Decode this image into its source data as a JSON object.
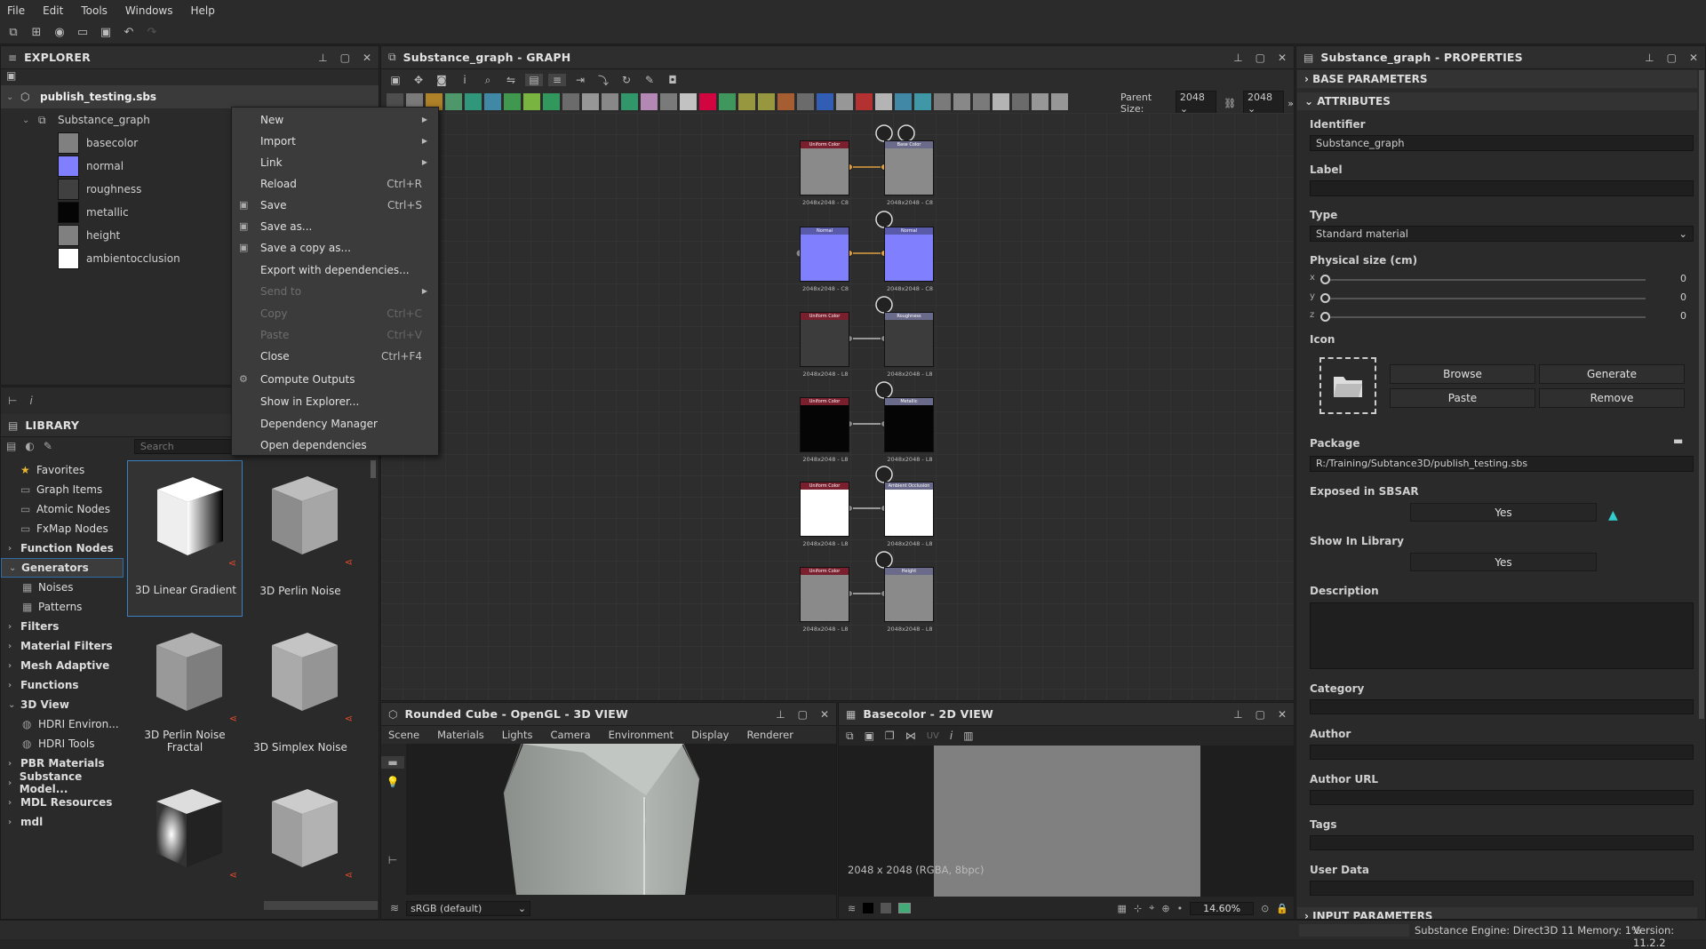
{
  "menubar": {
    "items": [
      "File",
      "Edit",
      "Tools",
      "Windows",
      "Help"
    ]
  },
  "explorer": {
    "title": "EXPLORER",
    "package": "publish_testing.sbs",
    "graph": "Substance_graph",
    "outputs": [
      {
        "name": "basecolor",
        "color": "#808080"
      },
      {
        "name": "normal",
        "color": "#8080ff"
      },
      {
        "name": "roughness",
        "color": "#404040"
      },
      {
        "name": "metallic",
        "color": "#050505"
      },
      {
        "name": "height",
        "color": "#808080"
      },
      {
        "name": "ambientocclusion",
        "color": "#ffffff"
      }
    ]
  },
  "context_menu": {
    "items": [
      {
        "label": "New",
        "shortcut": "",
        "submenu": true,
        "disabled": false
      },
      {
        "label": "Import",
        "shortcut": "",
        "submenu": true,
        "disabled": false
      },
      {
        "label": "Link",
        "shortcut": "",
        "submenu": true,
        "disabled": false
      },
      {
        "label": "Reload",
        "shortcut": "Ctrl+R",
        "submenu": false,
        "disabled": false
      },
      {
        "label": "Save",
        "shortcut": "Ctrl+S",
        "submenu": false,
        "disabled": false
      },
      {
        "label": "Save as...",
        "shortcut": "",
        "submenu": false,
        "disabled": false
      },
      {
        "label": "Save a copy as...",
        "shortcut": "",
        "submenu": false,
        "disabled": false
      },
      {
        "label": "Export with dependencies...",
        "shortcut": "",
        "submenu": false,
        "disabled": false
      },
      {
        "label": "Send to",
        "shortcut": "",
        "submenu": true,
        "disabled": true
      },
      {
        "label": "Copy",
        "shortcut": "Ctrl+C",
        "submenu": false,
        "disabled": true
      },
      {
        "label": "Paste",
        "shortcut": "Ctrl+V",
        "submenu": false,
        "disabled": true
      },
      {
        "label": "Close",
        "shortcut": "Ctrl+F4",
        "submenu": false,
        "disabled": false
      },
      {
        "label": "Compute Outputs",
        "shortcut": "",
        "submenu": false,
        "disabled": false
      },
      {
        "label": "Show in Explorer...",
        "shortcut": "",
        "submenu": false,
        "disabled": false
      },
      {
        "label": "Dependency Manager",
        "shortcut": "",
        "submenu": false,
        "disabled": false
      },
      {
        "label": "Open dependencies",
        "shortcut": "",
        "submenu": false,
        "disabled": false
      }
    ]
  },
  "library": {
    "title": "LIBRARY",
    "search_placeholder": "Search",
    "categories": [
      {
        "label": "Favorites",
        "bold": false,
        "arrow": "",
        "icon": "star"
      },
      {
        "label": "Graph Items",
        "bold": false,
        "arrow": "",
        "icon": "box"
      },
      {
        "label": "Atomic Nodes",
        "bold": false,
        "arrow": "",
        "icon": "box"
      },
      {
        "label": "FxMap Nodes",
        "bold": false,
        "arrow": "",
        "icon": "box"
      },
      {
        "label": "Function Nodes",
        "bold": true,
        "arrow": "›",
        "icon": ""
      },
      {
        "label": "Generators",
        "bold": true,
        "arrow": "⌄",
        "icon": ""
      },
      {
        "label": "Noises",
        "bold": false,
        "arrow": "",
        "icon": "grid",
        "indent": true
      },
      {
        "label": "Patterns",
        "bold": false,
        "arrow": "",
        "icon": "grid",
        "indent": true
      },
      {
        "label": "Filters",
        "bold": true,
        "arrow": "›",
        "icon": ""
      },
      {
        "label": "Material Filters",
        "bold": true,
        "arrow": "›",
        "icon": ""
      },
      {
        "label": "Mesh Adaptive",
        "bold": true,
        "arrow": "›",
        "icon": ""
      },
      {
        "label": "Functions",
        "bold": true,
        "arrow": "›",
        "icon": ""
      },
      {
        "label": "3D View",
        "bold": true,
        "arrow": "⌄",
        "icon": ""
      },
      {
        "label": "HDRI Environ...",
        "bold": false,
        "arrow": "",
        "icon": "globe",
        "indent": true
      },
      {
        "label": "HDRI Tools",
        "bold": false,
        "arrow": "",
        "icon": "globe",
        "indent": true
      },
      {
        "label": "PBR Materials",
        "bold": true,
        "arrow": "›",
        "icon": ""
      },
      {
        "label": "Substance Model...",
        "bold": true,
        "arrow": "›",
        "icon": ""
      },
      {
        "label": "MDL Resources",
        "bold": true,
        "arrow": "›",
        "icon": ""
      },
      {
        "label": "mdl",
        "bold": true,
        "arrow": "›",
        "icon": ""
      }
    ],
    "items": [
      "3D Linear Gradient",
      "3D Perlin Noise",
      "3D Perlin Noise Fractal",
      "3D Simplex Noise",
      "",
      ""
    ]
  },
  "graph": {
    "title": "Substance_graph - GRAPH",
    "parent_size_label": "Parent Size:",
    "parent_size": "2048",
    "size": "2048",
    "rows": [
      {
        "in_header": "Uniform Color",
        "out_header": "Base Color",
        "in_color": "#8a8a8a",
        "out_color": "#8a8a8a",
        "hdr_in": "#7a1f2e",
        "hdr_out": "#6a6a8a",
        "size_in": "2048x2048 - C8",
        "size_out": "2048x2048 - C8",
        "link": "#e0a040"
      },
      {
        "in_header": "Normal",
        "out_header": "Normal",
        "in_color": "#8080ff",
        "out_color": "#8080ff",
        "hdr_in": "#5a5aaa",
        "hdr_out": "#5a5aaa",
        "size_in": "2048x2048 - C8",
        "size_out": "2048x2048 - C8",
        "link": "#e0a040"
      },
      {
        "in_header": "Uniform Color",
        "out_header": "Roughness",
        "in_color": "#3c3c3c",
        "out_color": "#3c3c3c",
        "hdr_in": "#7a1f2e",
        "hdr_out": "#6a6a8a",
        "size_in": "2048x2048 - L8",
        "size_out": "2048x2048 - L8",
        "link": "#bbbbbb"
      },
      {
        "in_header": "Uniform Color",
        "out_header": "Metallic",
        "in_color": "#050505",
        "out_color": "#050505",
        "hdr_in": "#7a1f2e",
        "hdr_out": "#6a6a8a",
        "size_in": "2048x2048 - L8",
        "size_out": "2048x2048 - L8",
        "link": "#bbbbbb"
      },
      {
        "in_header": "Uniform Color",
        "out_header": "Ambient Occlusion",
        "in_color": "#ffffff",
        "out_color": "#ffffff",
        "hdr_in": "#7a1f2e",
        "hdr_out": "#6a6a8a",
        "size_in": "2048x2048 - L8",
        "size_out": "2048x2048 - L8",
        "link": "#bbbbbb"
      },
      {
        "in_header": "Uniform Color",
        "out_header": "Height",
        "in_color": "#8a8a8a",
        "out_color": "#8a8a8a",
        "hdr_in": "#7a1f2e",
        "hdr_out": "#6a6a8a",
        "size_in": "2048x2048 - L8",
        "size_out": "2048x2048 - L8",
        "link": "#bbbbbb"
      }
    ]
  },
  "view3d": {
    "title": "Rounded Cube - OpenGL - 3D VIEW",
    "menu": [
      "Scene",
      "Materials",
      "Lights",
      "Camera",
      "Environment",
      "Display",
      "Renderer"
    ],
    "colorspace": "sRGB (default)"
  },
  "view2d": {
    "title": "Basecolor - 2D VIEW",
    "uv_label": "UV",
    "info": "2048 x 2048 (RGBA, 8bpc)",
    "zoom": "14.60%"
  },
  "properties": {
    "title": "Substance_graph - PROPERTIES",
    "sections": [
      "BASE PARAMETERS",
      "ATTRIBUTES",
      "INPUT PARAMETERS"
    ],
    "identifier_label": "Identifier",
    "identifier": "Substance_graph",
    "label_label": "Label",
    "label": "",
    "type_label": "Type",
    "type": "Standard material",
    "physical_label": "Physical size (cm)",
    "physical": [
      {
        "axis": "x",
        "value": "0"
      },
      {
        "axis": "y",
        "value": "0"
      },
      {
        "axis": "z",
        "value": "0"
      }
    ],
    "icon_label": "Icon",
    "buttons": {
      "browse": "Browse",
      "generate": "Generate",
      "paste": "Paste",
      "remove": "Remove"
    },
    "package_label": "Package",
    "package": "R:/Training/Subtance3D/publish_testing.sbs",
    "exposed_label": "Exposed in SBSAR",
    "exposed": "Yes",
    "show_lib_label": "Show In Library",
    "show_lib": "Yes",
    "description_label": "Description",
    "category_label": "Category",
    "author_label": "Author",
    "author_url_label": "Author URL",
    "tags_label": "Tags",
    "user_data_label": "User Data"
  },
  "status": {
    "engine": "Substance Engine: Direct3D 11  Memory: 1%",
    "version": "Version: 11.2.2"
  }
}
